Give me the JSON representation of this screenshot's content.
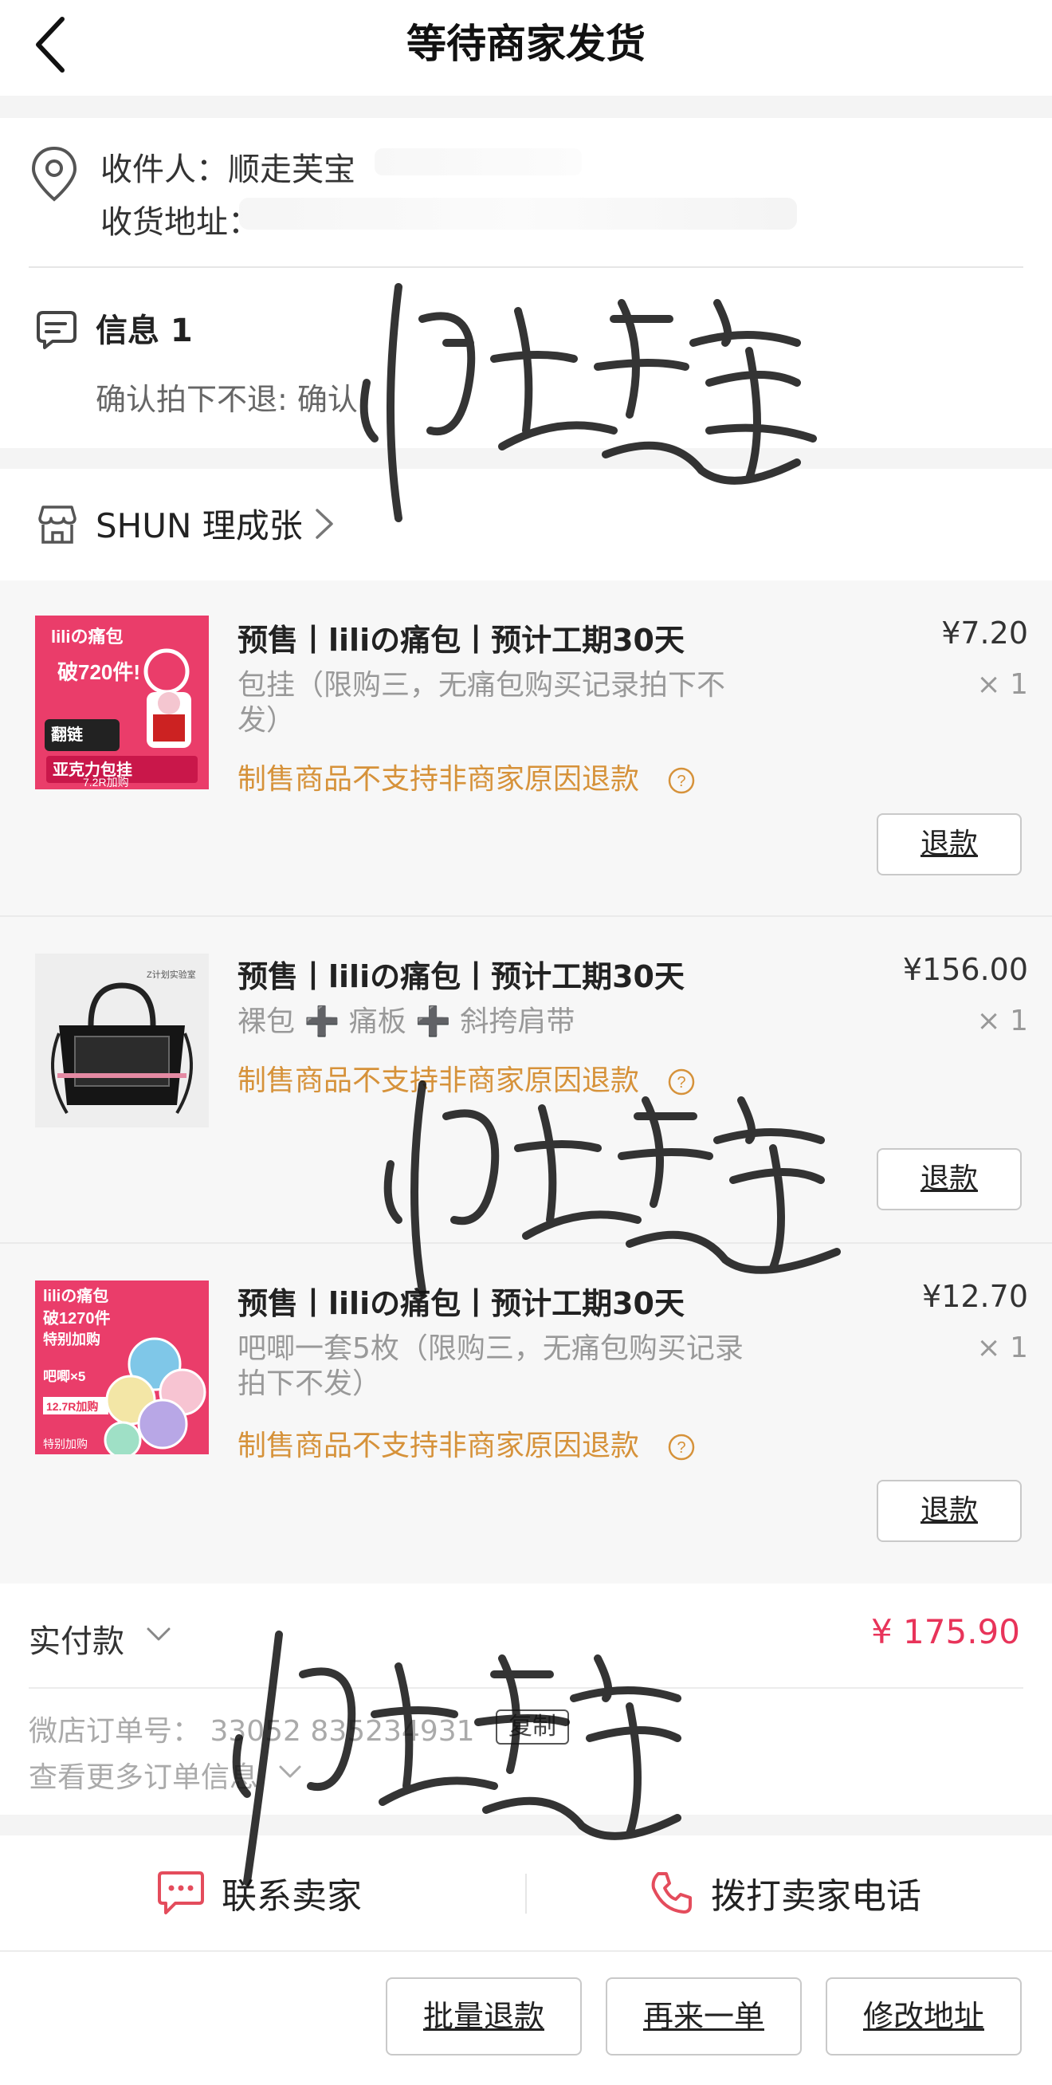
{
  "header": {
    "title": "等待商家发货"
  },
  "address": {
    "recipient": "收件人：顺走芙宝",
    "address_label": "收货地址："
  },
  "info": {
    "title": "信息 1",
    "text": "确认拍下不退: 确认"
  },
  "shop": {
    "name": "SHUN 理成张"
  },
  "items": [
    {
      "title": "预售丨liliの痛包丨预计工期30天",
      "variant": "包挂（限购三，无痛包购买记录拍下不发）",
      "price": "¥7.20",
      "qty": "× 1",
      "policy": "制售商品不支持非商家原因退款",
      "refund": "退款",
      "thumb": {
        "line1": "liliの痛包",
        "line2": "破720件!",
        "line3": "亚克力包挂",
        "line4": "7.2R加购",
        "tag": "翻链"
      }
    },
    {
      "title": "预售丨liliの痛包丨预计工期30天",
      "variant": "裸包 ➕ 痛板 ➕ 斜挎肩带",
      "price": "¥156.00",
      "qty": "× 1",
      "policy": "制售商品不支持非商家原因退款",
      "refund": "退款",
      "thumb": {
        "brand": "Z计划实验室"
      }
    },
    {
      "title": "预售丨liliの痛包丨预计工期30天",
      "variant": "吧唧一套5枚（限购三，无痛包购买记录拍下不发）",
      "price": "¥12.70",
      "qty": "× 1",
      "policy": "制售商品不支持非商家原因退款",
      "refund": "退款",
      "thumb": {
        "line1": "liliの痛包",
        "line2": "破1270件",
        "line3": "特别加购",
        "line4": "吧唧×5",
        "line5": "12.7R加购",
        "line6": "特别加购"
      }
    }
  ],
  "payment": {
    "label": "实付款",
    "amount": "¥ 175.90",
    "order_no": "微店订单号：  33052 835234931",
    "copy": "复制",
    "more": "查看更多订单信息"
  },
  "contact": {
    "seller": "联系卖家",
    "phone": "拨打卖家电话"
  },
  "footer": {
    "batch_refund": "批量退款",
    "reorder": "再来一单",
    "edit_address": "修改地址"
  },
  "colors": {
    "accent_red": "#e8345a",
    "policy_orange": "#d6923a",
    "icon_red": "#e44c5c"
  }
}
